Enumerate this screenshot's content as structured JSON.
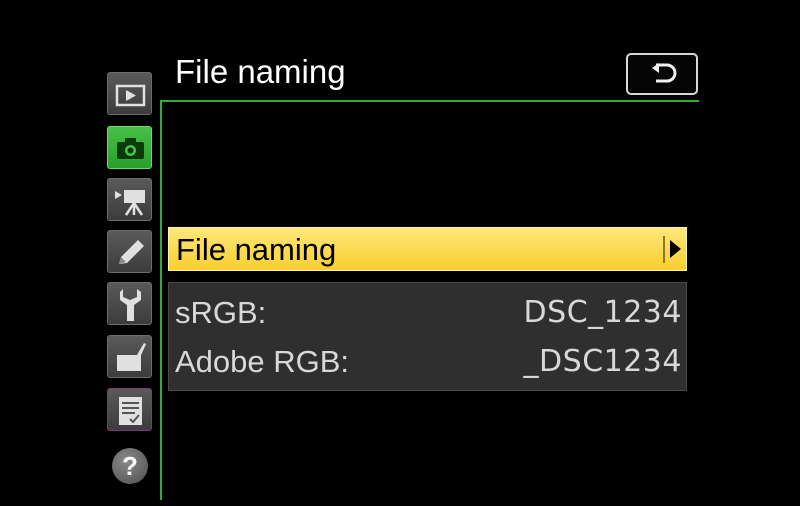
{
  "header": {
    "title": "File naming",
    "back_icon": "return-icon"
  },
  "sidebar": {
    "items": [
      {
        "name": "playback-menu",
        "icon": "playback-icon"
      },
      {
        "name": "photo-shooting-menu",
        "icon": "camera-icon",
        "active": true
      },
      {
        "name": "movie-shooting-menu",
        "icon": "movie-camera-icon"
      },
      {
        "name": "custom-settings-menu",
        "icon": "pencil-icon"
      },
      {
        "name": "setup-menu",
        "icon": "wrench-icon"
      },
      {
        "name": "retouch-menu",
        "icon": "retouch-brush-icon"
      },
      {
        "name": "my-menu",
        "icon": "my-menu-list-icon"
      }
    ],
    "help_label": "?"
  },
  "main": {
    "selected_item": {
      "label": "File naming"
    },
    "info": [
      {
        "key": "sRGB:",
        "value": "DSC_1234"
      },
      {
        "key": "Adobe RGB:",
        "value": "_DSC1234"
      }
    ]
  },
  "colors": {
    "accent_green": "#39a83a",
    "highlight_yellow": "#f7cf2f",
    "background": "#000000"
  }
}
